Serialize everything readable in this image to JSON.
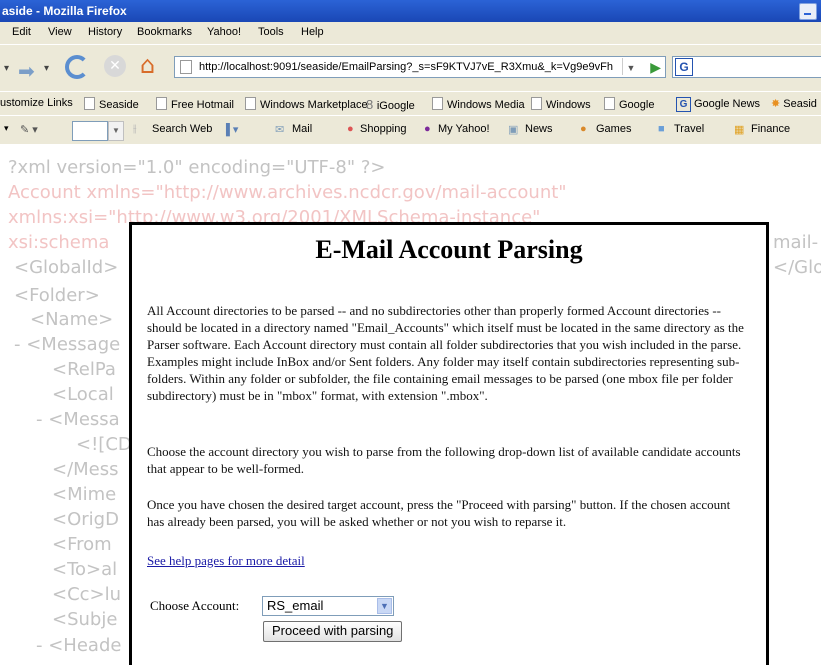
{
  "window": {
    "title": "aside - Mozilla Firefox"
  },
  "menu": [
    "Edit",
    "View",
    "History",
    "Bookmarks",
    "Yahoo!",
    "Tools",
    "Help"
  ],
  "nav": {
    "url": "http://localhost:9091/seaside/EmailParsing?_s=sF9KTVJ7vE_R3Xmu&_k=Vg9e9vFh",
    "search_letter": "G"
  },
  "links": [
    "ustomize Links",
    "Seaside",
    "Free Hotmail",
    "Windows Marketplace",
    "iGoogle",
    "Windows Media",
    "Windows",
    "Google",
    "Google News",
    "Seasid"
  ],
  "yahoo_toolbar": [
    "Search Web",
    "Mail",
    "Shopping",
    "My Yahoo!",
    "News",
    "Games",
    "Travel",
    "Finance"
  ],
  "xml_background": [
    "?xml version=\"1.0\" encoding=\"UTF-8\" ?>",
    "Account xmlns=\"http://www.archives.ncdcr.gov/mail-account\"",
    "xmlns:xsi=\"http://www.w3.org/2001/XMLSchema-instance\"",
    "xsi:schema",
    "<GlobalId>",
    "<Folder>",
    "<Name>",
    "- <Message",
    "<RelPa",
    "<Local",
    "- <Messa",
    "<![CD",
    "</Mess",
    "<Mime",
    "<OrigD",
    "<From",
    "<To>al",
    "<Cc>lu",
    "<Subje",
    "- <Heade",
    "mail-",
    "</Glo"
  ],
  "dialog": {
    "title": "E-Mail Account Parsing",
    "para1": "All Account directories to be parsed -- and no subdirectories other than properly formed Account directories -- should be located in a directory named \"Email_Accounts\" which itself must be located in the same directory as the Parser software. Each Account directory must contain all folder subdirectories that you wish included in the parse. Examples might include InBox and/or Sent folders. Any folder may itself contain subdirectories representing sub-folders. Within any folder or subfolder, the file containing email messages to be parsed (one mbox file per folder subdirectory) must be in \"mbox\" format, with extension \".mbox\".",
    "para2": "Choose the account directory you wish to parse from the following drop-down list of available candidate accounts that appear to be well-formed.",
    "para3": "Once you have chosen the desired target account, press the \"Proceed with parsing\" button. If the chosen account has already been parsed, you will be asked whether or not you wish to reparse it.",
    "help_link": "See help pages for more detail",
    "choose_label": "Choose Account:",
    "selected_account": "RS_email",
    "proceed_button": "Proceed with parsing"
  }
}
